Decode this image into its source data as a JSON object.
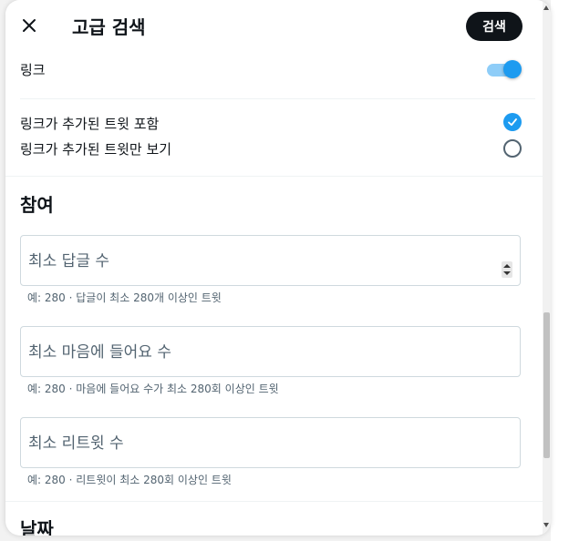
{
  "modal": {
    "title": "고급 검색",
    "search_label": "검색"
  },
  "links": {
    "label": "링크",
    "toggle_on": true,
    "options": [
      {
        "label": "링크가 추가된 트윗 포함",
        "checked": true
      },
      {
        "label": "링크가 추가된 트윗만 보기",
        "checked": false
      }
    ]
  },
  "engagement": {
    "title": "참여",
    "fields": [
      {
        "placeholder": "최소 답글 수",
        "hint": "예: 280 · 답글이 최소 280개 이상인 트윗"
      },
      {
        "placeholder": "최소 마음에 들어요 수",
        "hint": "예: 280 · 마음에 들어요 수가 최소 280회 이상인 트윗"
      },
      {
        "placeholder": "최소 리트윗 수",
        "hint": "예: 280 · 리트윗이 최소 280회 이상인 트윗"
      }
    ]
  },
  "dates": {
    "title": "날짜"
  },
  "colors": {
    "accent": "#1d9bf0",
    "primary_button": "#0f1419",
    "secondary_text": "#536471"
  }
}
